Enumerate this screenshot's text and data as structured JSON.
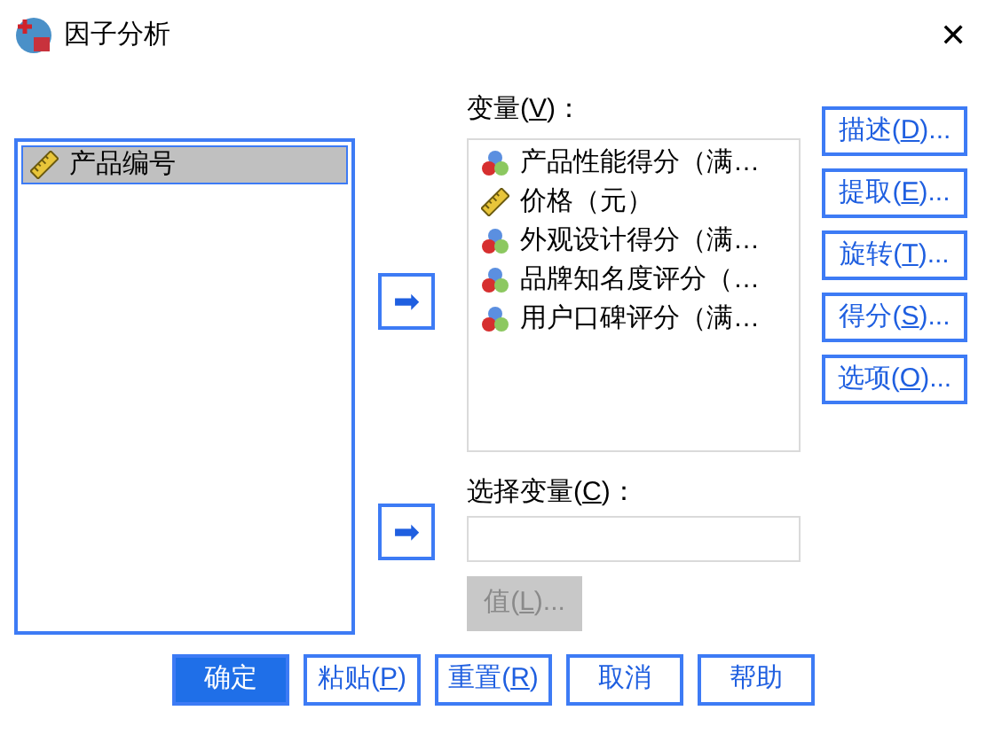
{
  "window": {
    "title": "因子分析",
    "close": "✕"
  },
  "source_list": {
    "items": [
      {
        "label": "产品编号",
        "kind": "scale",
        "selected": true
      }
    ]
  },
  "arrows": [
    {
      "glyph": "➡"
    },
    {
      "glyph": "➡"
    }
  ],
  "variables": {
    "label": {
      "before": "变量(",
      "key": "V",
      "after": ")："
    },
    "items": [
      {
        "label": "产品性能得分（满…",
        "kind": "nominal",
        "selected": false
      },
      {
        "label": "价格（元）",
        "kind": "scale",
        "selected": false
      },
      {
        "label": "外观设计得分（满…",
        "kind": "nominal",
        "selected": false
      },
      {
        "label": "品牌知名度评分（…",
        "kind": "nominal",
        "selected": false
      },
      {
        "label": "用户口碑评分（满…",
        "kind": "nominal",
        "selected": false
      }
    ]
  },
  "selection_variable": {
    "label": {
      "before": "选择变量(",
      "key": "C",
      "after": ")："
    },
    "value_button": {
      "before": "值(",
      "key": "L",
      "after": ")...",
      "disabled": true
    }
  },
  "side_buttons": [
    {
      "before": "描述(",
      "key": "D",
      "after": ")..."
    },
    {
      "before": "提取(",
      "key": "E",
      "after": ")..."
    },
    {
      "before": "旋转(",
      "key": "T",
      "after": ")..."
    },
    {
      "before": "得分(",
      "key": "S",
      "after": ")..."
    },
    {
      "before": "选项(",
      "key": "O",
      "after": ")..."
    }
  ],
  "bottom_buttons": [
    {
      "before": "确定",
      "default": true
    },
    {
      "before": "粘贴(",
      "key": "P",
      "after": ")",
      "default": false
    },
    {
      "before": "重置(",
      "key": "R",
      "after": ")",
      "default": false
    },
    {
      "before": "取消",
      "default": false
    },
    {
      "before": "帮助",
      "default": false
    }
  ]
}
